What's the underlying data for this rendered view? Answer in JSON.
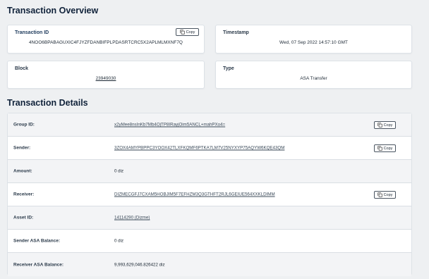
{
  "overview": {
    "title": "Transaction Overview",
    "transaction_id": {
      "label": "Transaction ID",
      "value": "4NOO6BPABAGUXIC4FJYZFDANBIFPLPDASRTCRC5X2APLMLMXNF7Q",
      "copy_label": "Copy"
    },
    "timestamp": {
      "label": "Timestamp",
      "value": "Wed, 07 Sep 2022 14:57:10 GMT"
    },
    "block": {
      "label": "Block",
      "value": "23949030"
    },
    "type": {
      "label": "Type",
      "value": "ASA Transfer"
    }
  },
  "details": {
    "title": "Transaction Details",
    "copy_label": "Copy",
    "rows": [
      {
        "label": "Group ID:",
        "value": "x2yMee8nsInKb7Mb4OjTP8IRayjOim5ANCL+mahPXo4="
      },
      {
        "label": "Sender:",
        "value": "3ZOX4AMYPBPPC3YOOX42TLXFKQMF6PTKA7LM7V25NYXYP75AQYW6KQE43QM"
      },
      {
        "label": "Amount:",
        "value": "0 diz"
      },
      {
        "label": "Receiver:",
        "value": "DIZMECGFJ7CXAM5HOBJIM5F7EFHZM3Q3GTHFT2RJL6GEIUE564XXKLDIMM"
      },
      {
        "label": "Asset ID:",
        "value": "14114290 (Dizme)"
      },
      {
        "label": "Sender ASA Balance:",
        "value": "0 diz"
      },
      {
        "label": "Receiver ASA Balance:",
        "value": "9,993,629,046.826422 diz"
      }
    ]
  }
}
